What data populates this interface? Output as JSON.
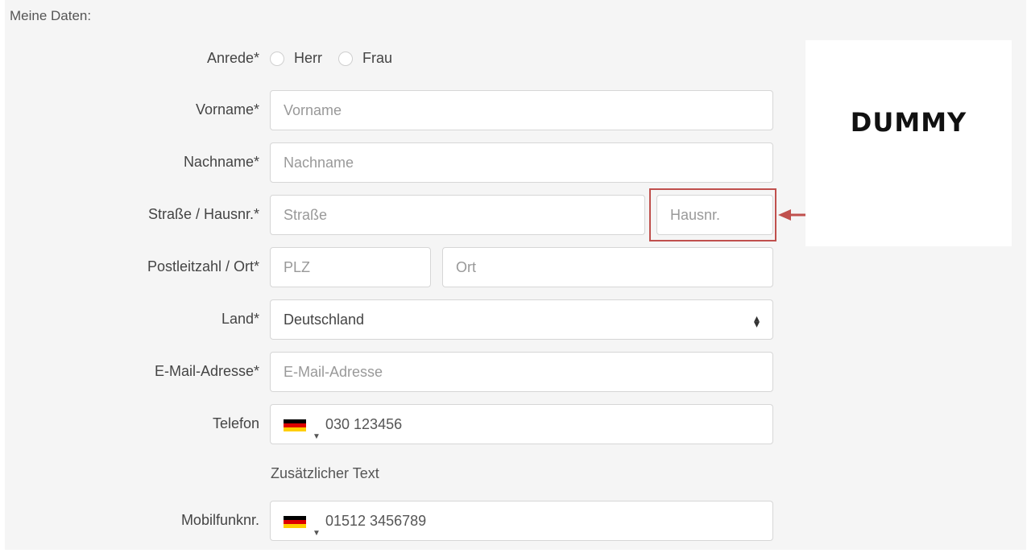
{
  "section": {
    "title": "Meine Daten:"
  },
  "salutation": {
    "label": "Anrede*",
    "options": [
      "Herr",
      "Frau"
    ]
  },
  "fields": {
    "first_name": {
      "label": "Vorname*",
      "placeholder": "Vorname"
    },
    "last_name": {
      "label": "Nachname*",
      "placeholder": "Nachname"
    },
    "street": {
      "label": "Straße / Hausnr.*",
      "placeholder": "Straße"
    },
    "house_number": {
      "placeholder": "Hausnr."
    },
    "postal": {
      "label": "Postleitzahl / Ort*",
      "placeholder": "PLZ"
    },
    "city": {
      "placeholder": "Ort"
    },
    "country": {
      "label": "Land*",
      "value": "Deutschland",
      "icon": "sort-arrows-icon"
    },
    "email": {
      "label": "E-Mail-Adresse*",
      "placeholder": "E-Mail-Adresse"
    },
    "phone": {
      "label": "Telefon",
      "value": "030 123456",
      "flag": "germany-flag-icon"
    },
    "helper_text": "Zusätzlicher Text",
    "mobile": {
      "label": "Mobilfunknr.",
      "value": "01512 3456789",
      "flag": "germany-flag-icon"
    }
  },
  "logo": {
    "text": "DUMMY"
  },
  "annotation": {
    "highlight_color": "#c0504d"
  }
}
